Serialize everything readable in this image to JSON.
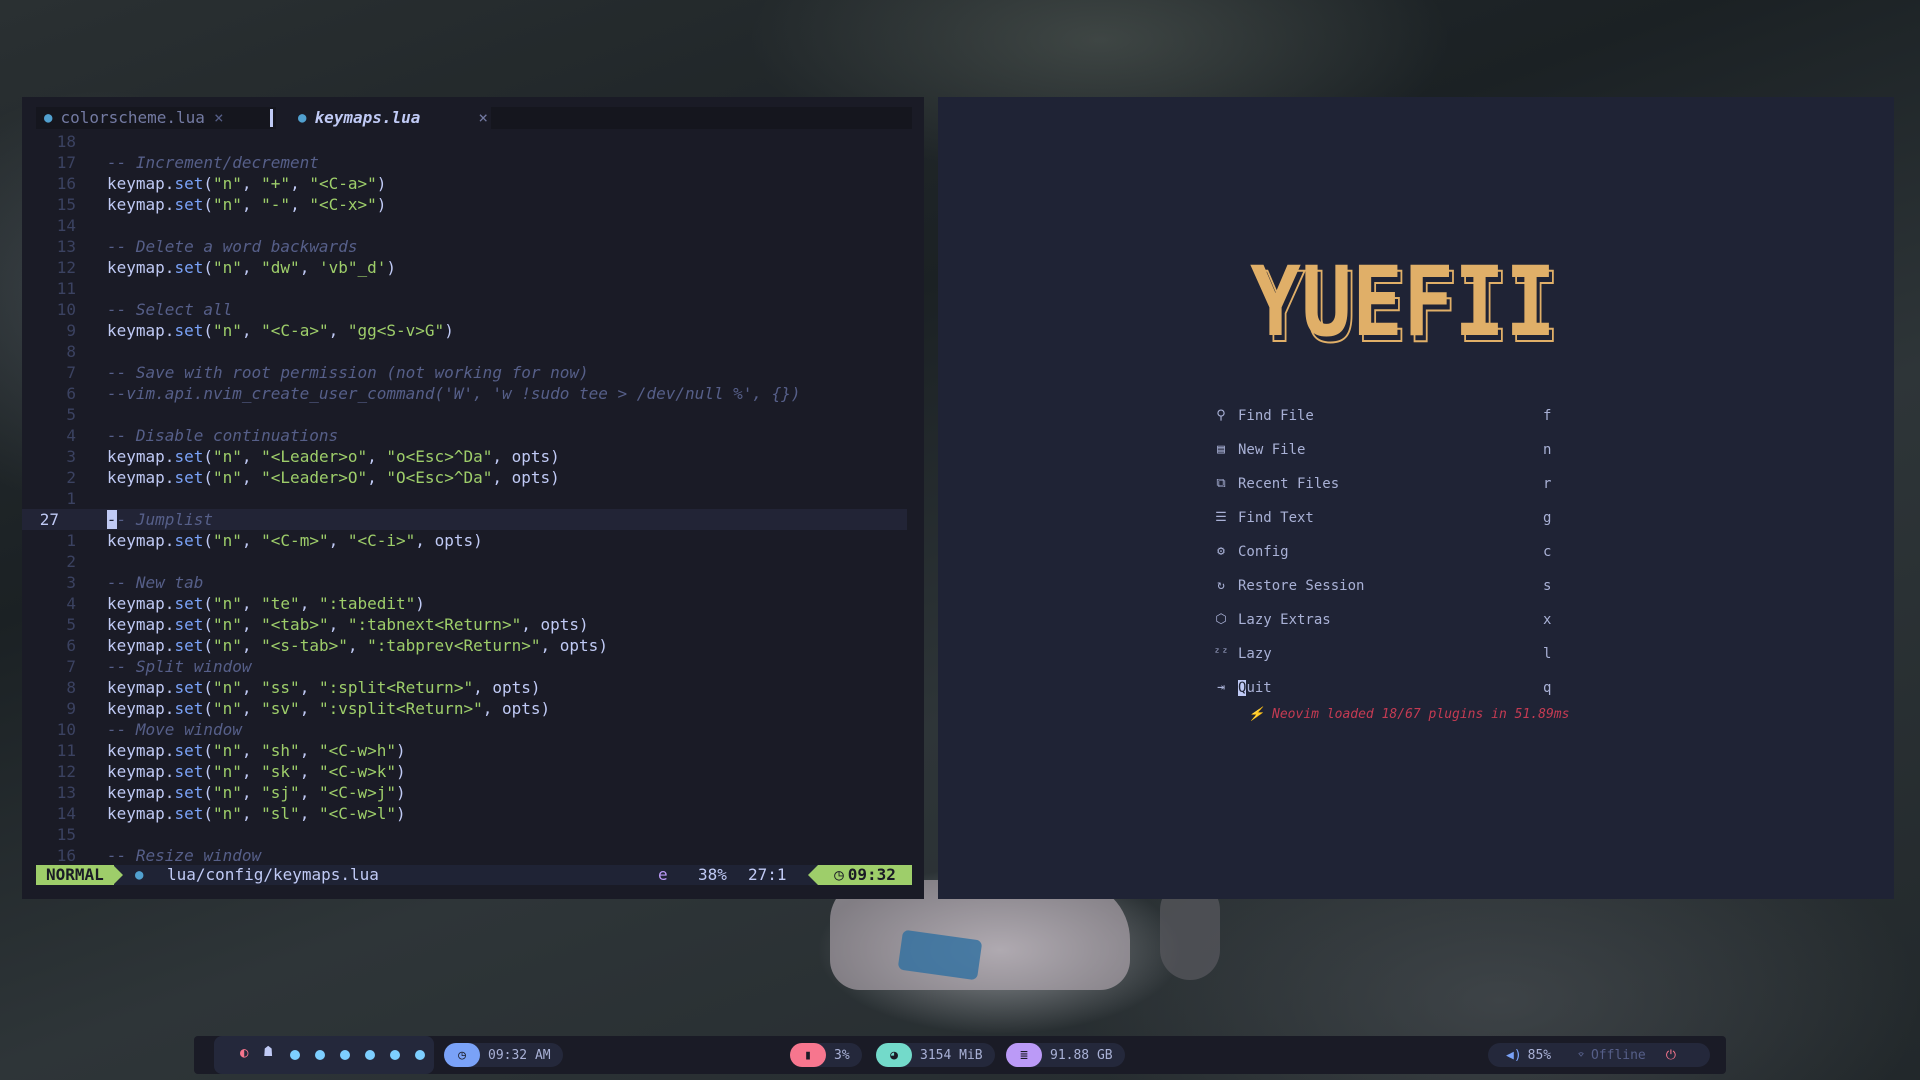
{
  "editor": {
    "tabs": [
      {
        "label": "colorscheme.lua",
        "close": "×"
      },
      {
        "label": "keymaps.lua",
        "close": "×"
      }
    ],
    "lines": [
      {
        "n": "18",
        "cur": false,
        "parts": []
      },
      {
        "n": "17",
        "cur": false,
        "parts": [
          [
            "cm",
            "-- Increment/decrement"
          ]
        ]
      },
      {
        "n": "16",
        "cur": false,
        "parts": [
          [
            "pl",
            "keymap."
          ],
          [
            "fn",
            "set"
          ],
          [
            "pl",
            "("
          ],
          [
            "str",
            "\"n\""
          ],
          [
            "pl",
            ", "
          ],
          [
            "str",
            "\"+\""
          ],
          [
            "pl",
            ", "
          ],
          [
            "str",
            "\"<C-a>\""
          ],
          [
            "pl",
            ")"
          ]
        ]
      },
      {
        "n": "15",
        "cur": false,
        "parts": [
          [
            "pl",
            "keymap."
          ],
          [
            "fn",
            "set"
          ],
          [
            "pl",
            "("
          ],
          [
            "str",
            "\"n\""
          ],
          [
            "pl",
            ", "
          ],
          [
            "str",
            "\"-\""
          ],
          [
            "pl",
            ", "
          ],
          [
            "str",
            "\"<C-x>\""
          ],
          [
            "pl",
            ")"
          ]
        ]
      },
      {
        "n": "14",
        "cur": false,
        "parts": []
      },
      {
        "n": "13",
        "cur": false,
        "parts": [
          [
            "cm",
            "-- Delete a word backwards"
          ]
        ]
      },
      {
        "n": "12",
        "cur": false,
        "parts": [
          [
            "pl",
            "keymap."
          ],
          [
            "fn",
            "set"
          ],
          [
            "pl",
            "("
          ],
          [
            "str",
            "\"n\""
          ],
          [
            "pl",
            ", "
          ],
          [
            "str",
            "\"dw\""
          ],
          [
            "pl",
            ", "
          ],
          [
            "str",
            "'vb\"_d'"
          ],
          [
            "pl",
            ")"
          ]
        ]
      },
      {
        "n": "11",
        "cur": false,
        "parts": []
      },
      {
        "n": "10",
        "cur": false,
        "parts": [
          [
            "cm",
            "-- Select all"
          ]
        ]
      },
      {
        "n": "9",
        "cur": false,
        "parts": [
          [
            "pl",
            "keymap."
          ],
          [
            "fn",
            "set"
          ],
          [
            "pl",
            "("
          ],
          [
            "str",
            "\"n\""
          ],
          [
            "pl",
            ", "
          ],
          [
            "str",
            "\"<C-a>\""
          ],
          [
            "pl",
            ", "
          ],
          [
            "str",
            "\"gg<S-v>G\""
          ],
          [
            "pl",
            ")"
          ]
        ]
      },
      {
        "n": "8",
        "cur": false,
        "parts": []
      },
      {
        "n": "7",
        "cur": false,
        "parts": [
          [
            "cm",
            "-- Save with root permission (not working for now)"
          ]
        ]
      },
      {
        "n": "6",
        "cur": false,
        "parts": [
          [
            "cm",
            "--vim.api.nvim_create_user_command('W', 'w !sudo tee > /dev/null %', {})"
          ]
        ]
      },
      {
        "n": "5",
        "cur": false,
        "parts": []
      },
      {
        "n": "4",
        "cur": false,
        "parts": [
          [
            "cm",
            "-- Disable continuations"
          ]
        ]
      },
      {
        "n": "3",
        "cur": false,
        "parts": [
          [
            "pl",
            "keymap."
          ],
          [
            "fn",
            "set"
          ],
          [
            "pl",
            "("
          ],
          [
            "str",
            "\"n\""
          ],
          [
            "pl",
            ", "
          ],
          [
            "str",
            "\"<Leader>o\""
          ],
          [
            "pl",
            ", "
          ],
          [
            "str",
            "\"o<Esc>^Da\""
          ],
          [
            "pl",
            ", opts)"
          ]
        ]
      },
      {
        "n": "2",
        "cur": false,
        "parts": [
          [
            "pl",
            "keymap."
          ],
          [
            "fn",
            "set"
          ],
          [
            "pl",
            "("
          ],
          [
            "str",
            "\"n\""
          ],
          [
            "pl",
            ", "
          ],
          [
            "str",
            "\"<Leader>O\""
          ],
          [
            "pl",
            ", "
          ],
          [
            "str",
            "\"O<Esc>^Da\""
          ],
          [
            "pl",
            ", opts)"
          ]
        ]
      },
      {
        "n": "1",
        "cur": false,
        "parts": []
      },
      {
        "n": "27",
        "cur": true,
        "parts": [
          [
            "cm",
            "-- Jumplist"
          ]
        ]
      },
      {
        "n": "1",
        "cur": false,
        "parts": [
          [
            "pl",
            "keymap."
          ],
          [
            "fn",
            "set"
          ],
          [
            "pl",
            "("
          ],
          [
            "str",
            "\"n\""
          ],
          [
            "pl",
            ", "
          ],
          [
            "str",
            "\"<C-m>\""
          ],
          [
            "pl",
            ", "
          ],
          [
            "str",
            "\"<C-i>\""
          ],
          [
            "pl",
            ", opts)"
          ]
        ]
      },
      {
        "n": "2",
        "cur": false,
        "parts": []
      },
      {
        "n": "3",
        "cur": false,
        "parts": [
          [
            "cm",
            "-- New tab"
          ]
        ]
      },
      {
        "n": "4",
        "cur": false,
        "parts": [
          [
            "pl",
            "keymap."
          ],
          [
            "fn",
            "set"
          ],
          [
            "pl",
            "("
          ],
          [
            "str",
            "\"n\""
          ],
          [
            "pl",
            ", "
          ],
          [
            "str",
            "\"te\""
          ],
          [
            "pl",
            ", "
          ],
          [
            "str",
            "\":tabedit\""
          ],
          [
            "pl",
            ")"
          ]
        ]
      },
      {
        "n": "5",
        "cur": false,
        "parts": [
          [
            "pl",
            "keymap."
          ],
          [
            "fn",
            "set"
          ],
          [
            "pl",
            "("
          ],
          [
            "str",
            "\"n\""
          ],
          [
            "pl",
            ", "
          ],
          [
            "str",
            "\"<tab>\""
          ],
          [
            "pl",
            ", "
          ],
          [
            "str",
            "\":tabnext<Return>\""
          ],
          [
            "pl",
            ", opts)"
          ]
        ]
      },
      {
        "n": "6",
        "cur": false,
        "parts": [
          [
            "pl",
            "keymap."
          ],
          [
            "fn",
            "set"
          ],
          [
            "pl",
            "("
          ],
          [
            "str",
            "\"n\""
          ],
          [
            "pl",
            ", "
          ],
          [
            "str",
            "\"<s-tab>\""
          ],
          [
            "pl",
            ", "
          ],
          [
            "str",
            "\":tabprev<Return>\""
          ],
          [
            "pl",
            ", opts)"
          ]
        ]
      },
      {
        "n": "7",
        "cur": false,
        "parts": [
          [
            "cm",
            "-- Split window"
          ]
        ]
      },
      {
        "n": "8",
        "cur": false,
        "parts": [
          [
            "pl",
            "keymap."
          ],
          [
            "fn",
            "set"
          ],
          [
            "pl",
            "("
          ],
          [
            "str",
            "\"n\""
          ],
          [
            "pl",
            ", "
          ],
          [
            "str",
            "\"ss\""
          ],
          [
            "pl",
            ", "
          ],
          [
            "str",
            "\":split<Return>\""
          ],
          [
            "pl",
            ", opts)"
          ]
        ]
      },
      {
        "n": "9",
        "cur": false,
        "parts": [
          [
            "pl",
            "keymap."
          ],
          [
            "fn",
            "set"
          ],
          [
            "pl",
            "("
          ],
          [
            "str",
            "\"n\""
          ],
          [
            "pl",
            ", "
          ],
          [
            "str",
            "\"sv\""
          ],
          [
            "pl",
            ", "
          ],
          [
            "str",
            "\":vsplit<Return>\""
          ],
          [
            "pl",
            ", opts)"
          ]
        ]
      },
      {
        "n": "10",
        "cur": false,
        "parts": [
          [
            "cm",
            "-- Move window"
          ]
        ]
      },
      {
        "n": "11",
        "cur": false,
        "parts": [
          [
            "pl",
            "keymap."
          ],
          [
            "fn",
            "set"
          ],
          [
            "pl",
            "("
          ],
          [
            "str",
            "\"n\""
          ],
          [
            "pl",
            ", "
          ],
          [
            "str",
            "\"sh\""
          ],
          [
            "pl",
            ", "
          ],
          [
            "str",
            "\"<C-w>h\""
          ],
          [
            "pl",
            ")"
          ]
        ]
      },
      {
        "n": "12",
        "cur": false,
        "parts": [
          [
            "pl",
            "keymap."
          ],
          [
            "fn",
            "set"
          ],
          [
            "pl",
            "("
          ],
          [
            "str",
            "\"n\""
          ],
          [
            "pl",
            ", "
          ],
          [
            "str",
            "\"sk\""
          ],
          [
            "pl",
            ", "
          ],
          [
            "str",
            "\"<C-w>k\""
          ],
          [
            "pl",
            ")"
          ]
        ]
      },
      {
        "n": "13",
        "cur": false,
        "parts": [
          [
            "pl",
            "keymap."
          ],
          [
            "fn",
            "set"
          ],
          [
            "pl",
            "("
          ],
          [
            "str",
            "\"n\""
          ],
          [
            "pl",
            ", "
          ],
          [
            "str",
            "\"sj\""
          ],
          [
            "pl",
            ", "
          ],
          [
            "str",
            "\"<C-w>j\""
          ],
          [
            "pl",
            ")"
          ]
        ]
      },
      {
        "n": "14",
        "cur": false,
        "parts": [
          [
            "pl",
            "keymap."
          ],
          [
            "fn",
            "set"
          ],
          [
            "pl",
            "("
          ],
          [
            "str",
            "\"n\""
          ],
          [
            "pl",
            ", "
          ],
          [
            "str",
            "\"sl\""
          ],
          [
            "pl",
            ", "
          ],
          [
            "str",
            "\"<C-w>l\""
          ],
          [
            "pl",
            ")"
          ]
        ]
      },
      {
        "n": "15",
        "cur": false,
        "parts": []
      },
      {
        "n": "16",
        "cur": false,
        "parts": [
          [
            "cm",
            "-- Resize window"
          ]
        ]
      }
    ],
    "status": {
      "mode": "NORMAL",
      "file": "lua/config/keymaps.lua",
      "encoding_flag": "e",
      "percent": "38%",
      "position": "27:1",
      "clock": "09:32"
    }
  },
  "dashboard": {
    "logo": "YUEFII",
    "menu": [
      {
        "icon": "search-icon",
        "glyph": "⚲",
        "label": "Find File",
        "key": "f"
      },
      {
        "icon": "file-icon",
        "glyph": "▤",
        "label": "New File",
        "key": "n"
      },
      {
        "icon": "recent-files-icon",
        "glyph": "⧉",
        "label": "Recent Files",
        "key": "r"
      },
      {
        "icon": "find-text-icon",
        "glyph": "☰",
        "label": "Find Text",
        "key": "g"
      },
      {
        "icon": "gear-icon",
        "glyph": "⚙",
        "label": "Config",
        "key": "c"
      },
      {
        "icon": "restore-icon",
        "glyph": "↻",
        "label": "Restore Session",
        "key": "s"
      },
      {
        "icon": "extras-icon",
        "glyph": "⬡",
        "label": "Lazy Extras",
        "key": "x"
      },
      {
        "icon": "lazy-icon",
        "glyph": "ᶻᶻ",
        "label": "Lazy",
        "key": "l"
      },
      {
        "icon": "quit-icon",
        "glyph": "⇥",
        "label": "Quit",
        "key": "q"
      }
    ],
    "loaded_msg": "Neovim loaded 18/67 plugins in 51.89ms"
  },
  "bar": {
    "clock": "09:32 AM",
    "cpu": "3%",
    "memory": "3154 MiB",
    "disk": "91.88 GB",
    "volume": "85%",
    "network": "Offline",
    "colors": {
      "clock": "#7aa2f7",
      "cpu": "#f7768e",
      "memory": "#73daca",
      "disk": "#bb9af7"
    }
  }
}
